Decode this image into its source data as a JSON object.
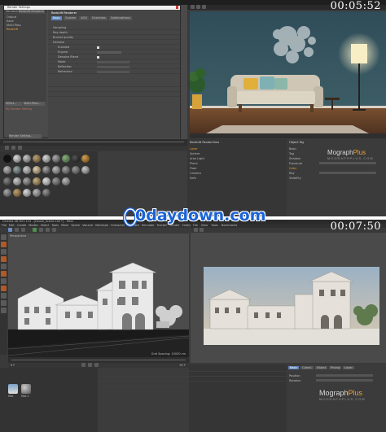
{
  "timecode_top": "00:05:52",
  "timecode_bottom": "00:07:50",
  "watermark": "0daydown.com",
  "brand": {
    "name": "Mograph",
    "accent": "Plus",
    "sub": "MOGRAPHPLUS.COM"
  },
  "top": {
    "dialog_title": "Render Settings",
    "renderer_label": "Renderer",
    "renderer_value": "Redshift Renderer",
    "settings_items": [
      "Output",
      "Save",
      "Multi-Pass",
      "Redshift"
    ],
    "tabs": [
      "Basic",
      "System",
      "AOV",
      "Overrides",
      "Optimizations"
    ],
    "tab_header": "Redshift Renderer",
    "rows": [
      "Sampling",
      "Ray depth",
      "Bucket quality",
      "Denoise",
      "Enabled",
      "Engine",
      "Denoise Blend",
      "Mode",
      "Reflection",
      "Refraction"
    ],
    "effect_button": "Effect...",
    "multipass_button": "Multi-Pass...",
    "my_setting": "My Render Setting",
    "render_setting_button": "Render Setting...",
    "frame_label": "Frame",
    "buttons_bottom": [
      "OK",
      "Cancel"
    ],
    "viewer_header": "Redshift RenderView",
    "layers": [
      "Layer",
      "Sphere",
      "Area Light",
      "Plane",
      "Floor",
      "Camera",
      "Sofa"
    ],
    "attr_header": "Object Tag",
    "attr_rows": [
      "Basic",
      "Tag",
      "Shadow",
      "Exposure",
      "Color",
      "Ray",
      "Visibility"
    ]
  },
  "bottom": {
    "menus": [
      "File",
      "Edit",
      "Create",
      "Modes",
      "Select",
      "Tools",
      "Mesh",
      "Spline",
      "Volume",
      "MoGraph",
      "Character",
      "Animate",
      "Simulate",
      "Tracker",
      "Render",
      "Extensions",
      "Window",
      "Help"
    ],
    "viewport_label": "Perspective",
    "grid_label": "Grid Spacing: 10000 cm",
    "title": "Cinema 4D R21.115 - [House_Scene.c4d *] - Main",
    "rv_menus": [
      "File",
      "View",
      "Tools",
      "Bookmarks"
    ],
    "materials": [
      "Mat",
      "Mat.1"
    ],
    "frame_start": "0 F",
    "frame_end": "90 F",
    "attr_rows": [
      "Basic",
      "Coord.",
      "Object",
      "Phong",
      "Layer",
      "Position",
      "Rotation"
    ]
  },
  "colors": {
    "panel": "#3a3a3a",
    "dark": "#2c2c2c",
    "accent_orange": "#f0a030",
    "watermark_blue": "#1a63d6",
    "selection_blue": "#3e6ea8"
  }
}
